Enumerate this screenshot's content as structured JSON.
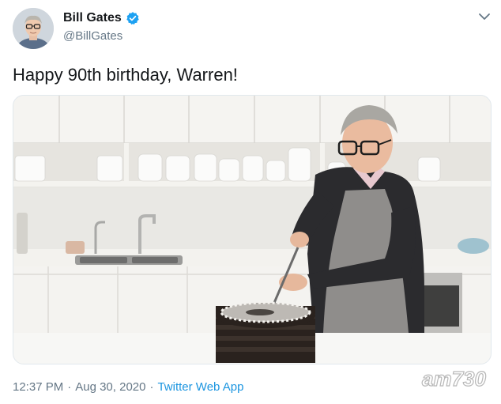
{
  "author": {
    "display_name": "Bill Gates",
    "handle": "@BillGates",
    "verified": true,
    "avatar_icon": "avatar-photo"
  },
  "tweet": {
    "text": "Happy 90th birthday, Warren!"
  },
  "meta": {
    "time": "12:37 PM",
    "separator": "·",
    "date": "Aug 30, 2020",
    "source": "Twitter Web App"
  },
  "media": {
    "description_icon": "photo-media"
  },
  "watermark": {
    "text": "am730"
  },
  "colors": {
    "text_primary": "#14171a",
    "text_secondary": "#657786",
    "link": "#1b95e0",
    "verified": "#1da1f2"
  }
}
